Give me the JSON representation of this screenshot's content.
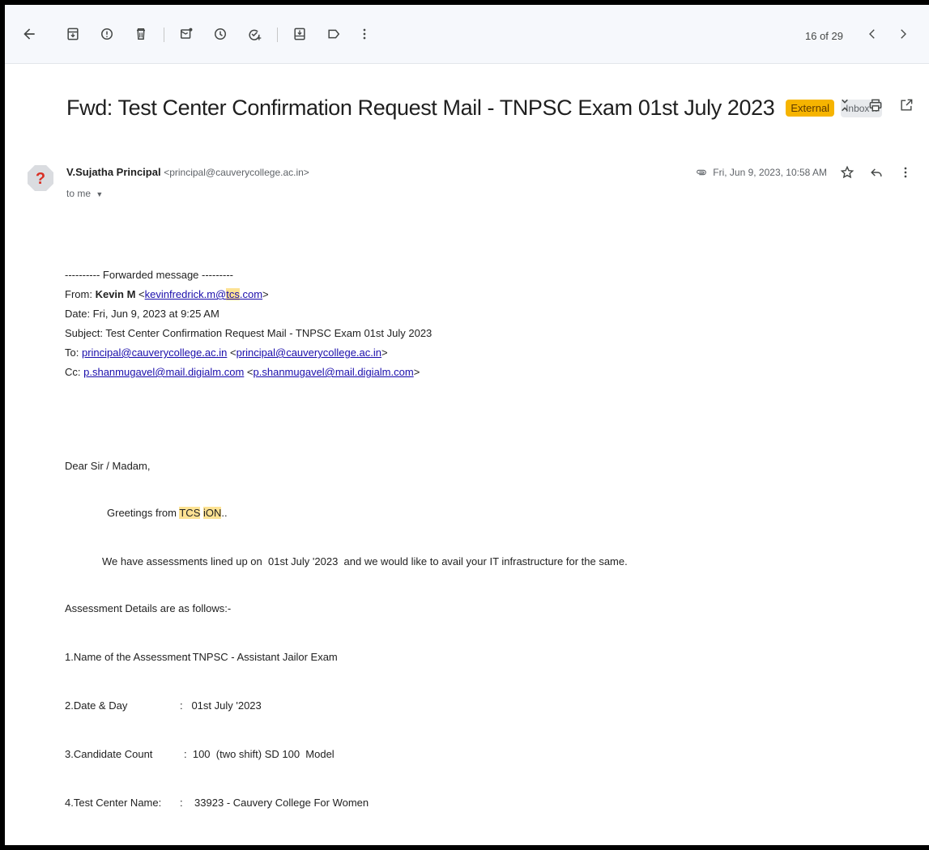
{
  "toolbar": {
    "pager": "16 of 29",
    "icons": [
      "back-icon",
      "archive-icon",
      "report-spam-icon",
      "delete-icon",
      "mark-unread-icon",
      "snooze-icon",
      "add-task-icon",
      "move-to-icon",
      "label-icon",
      "more-vert-icon",
      "newer-icon",
      "older-icon"
    ]
  },
  "message": {
    "subject": "Fwd: Test Center Confirmation Request Mail - TNPSC Exam 01st July 2023",
    "labels": {
      "external": "External",
      "inbox": "Inbox x"
    },
    "sender_name": "V.Sujatha Principal",
    "sender_email": "<principal@cauverycollege.ac.in>",
    "to": "to me",
    "date": "Fri, Jun 9, 2023, 10:58 AM",
    "avatar_glyph": "?"
  },
  "forwarded": {
    "header": "---------- Forwarded message ---------",
    "from_label": "From:",
    "from_name": "Kevin M",
    "from_lt": "<",
    "from_email_a": "kevinfredrick.m@",
    "from_email_b": "tcs",
    "from_email_c": ".com",
    "from_gt": ">",
    "date_line": "Date: Fri, Jun 9, 2023 at 9:25 AM",
    "subject_line": "Subject: Test Center Confirmation Request Mail - TNPSC Exam 01st July 2023",
    "to_label": "To:",
    "to_email": "principal@cauverycollege.ac.in",
    "to_lt": " <",
    "to_email2": "principal@cauverycollege.ac.in",
    "to_gt": ">",
    "cc_label": "Cc:",
    "cc_email": "p.shanmugavel@mail.digialm.com",
    "cc_lt": " <",
    "cc_email2": "p.shanmugavel@mail.digialm.com",
    "cc_gt": ">"
  },
  "content": {
    "greeting": "Dear Sir / Madam,",
    "greetings_pre": "Greetings from ",
    "greetings_tcs": "TCS",
    "greetings_ion": "iON",
    "greetings_post": "..",
    "intro": "We have assessments lined up on  01st July '2023  and we would like to avail your IT infrastructure for the same.",
    "details_heading": "Assessment Details are as follows:-",
    "details": [
      {
        "label": "1.Name of the Assessment",
        "value": ":  TNPSC - Assistant Jailor Exam"
      },
      {
        "label": "2.Date & Day",
        "value": ":   01st July '2023"
      },
      {
        "label": "3.Candidate Count",
        "value": ":  100  (two shift) SD 100  Model"
      },
      {
        "label": "4.Test Center Name:",
        "value": ":    33923 - Cauvery College For Women"
      }
    ]
  }
}
